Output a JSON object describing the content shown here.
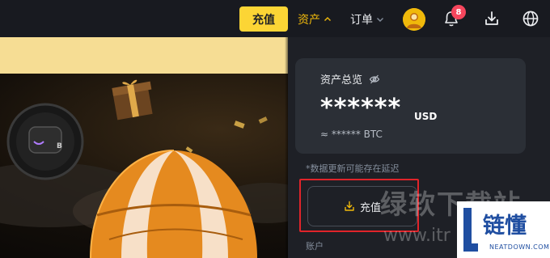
{
  "topbar": {
    "deposit_label": "充值",
    "assets_label": "资产",
    "orders_label": "订单",
    "notification_count": "8",
    "colors": {
      "accent": "#fcd535",
      "active": "#f0b90b",
      "badge": "#f6465d"
    }
  },
  "assets_panel": {
    "title": "资产总览",
    "balance_masked": "******",
    "currency": "USD",
    "btc_estimate": "≈ ****** BTC",
    "update_note": "*数据更新可能存在延迟",
    "deposit_label": "充值",
    "account_label": "账户"
  },
  "watermark": {
    "site_name": "绿软下载站",
    "url": "www.itr",
    "logo_text": "链懂",
    "logo_sub": "NEATDOWN.COM"
  }
}
